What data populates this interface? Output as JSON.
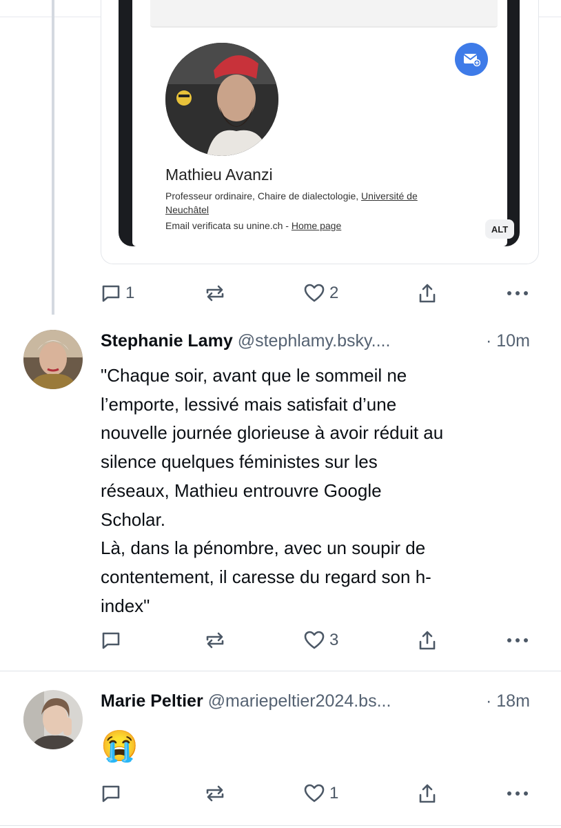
{
  "embed": {
    "profile_name": "Mathieu Avanzi",
    "affiliation_prefix": "Professeur ordinaire, Chaire de dialectologie, ",
    "affiliation_link_1": "Université de",
    "affiliation_link_2": "Neuchâtel",
    "email_prefix": "Email verificata su unine.ch - ",
    "homepage_link": "Home page",
    "alt_label": "ALT"
  },
  "post0": {
    "reply_count": "1",
    "repost_count": "",
    "like_count": "2"
  },
  "post1": {
    "author": "Stephanie Lamy",
    "handle": "@stephlamy.bsky....",
    "time": "· 10m",
    "text": "\"Chaque soir, avant que le sommeil ne\nl’emporte, lessivé mais satisfait d’une\nnouvelle journée glorieuse à avoir réduit au\nsilence quelques féministes sur les\nréseaux, Mathieu entrouvre Google\nScholar.\nLà, dans la pénombre, avec un soupir de\ncontentement, il caresse du regard son h-\nindex\"",
    "reply_count": "",
    "like_count": "3"
  },
  "post2": {
    "author": "Marie Peltier",
    "handle": "@mariepeltier2024.bs...",
    "time": "· 18m",
    "text": "😭",
    "reply_count": "",
    "like_count": "1"
  },
  "colors": {
    "icon": "#4c5866",
    "accent_blue": "#3e7be8",
    "handle_gray": "#556272"
  }
}
